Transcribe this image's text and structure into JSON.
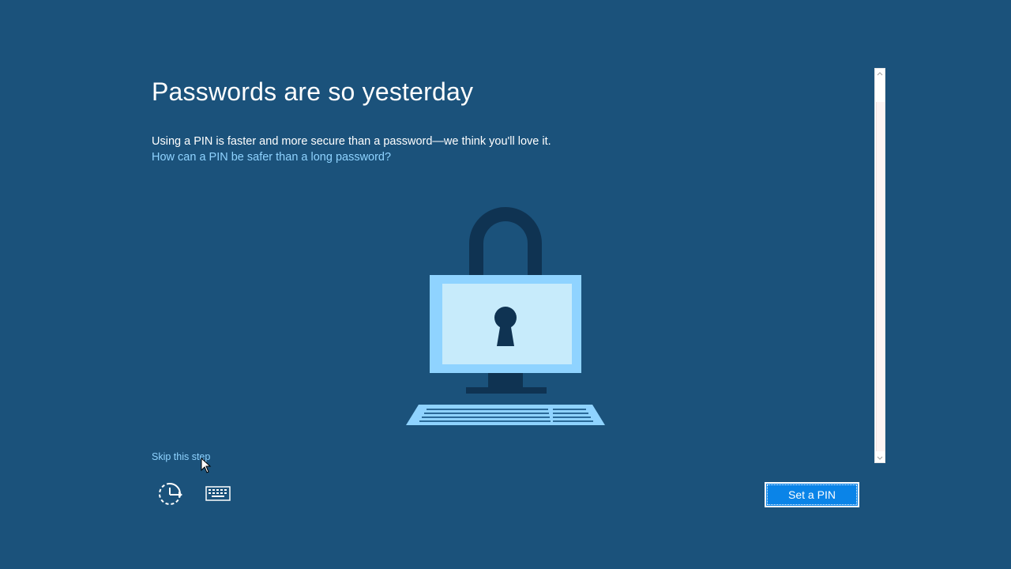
{
  "page": {
    "title": "Passwords are so yesterday",
    "description": "Using a PIN is faster and more secure than a password—we think you'll love it.",
    "info_link": "How can a PIN be safer than a long password?",
    "skip_link": "Skip this step",
    "primary_button": "Set a PIN"
  },
  "icons": {
    "illustration": "padlock-computer-icon",
    "ease_of_access": "ease-of-access-icon",
    "keyboard": "on-screen-keyboard-icon",
    "cursor": "mouse-pointer-icon"
  },
  "colors": {
    "background": "#1b527b",
    "link": "#8fd3ff",
    "primary_button": "#0a84e8",
    "padlock_dark": "#0f3352",
    "screen_light": "#c7ebfb",
    "screen_border": "#8fd3ff"
  }
}
